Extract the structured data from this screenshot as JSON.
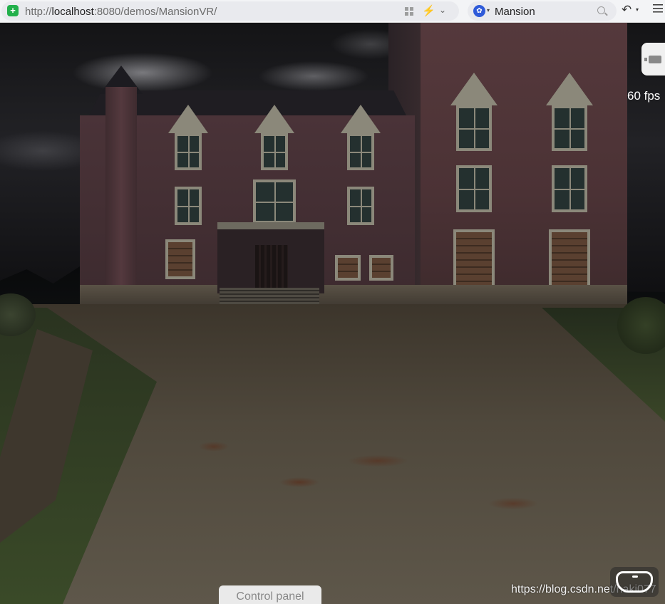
{
  "browser": {
    "url_prefix": "http://",
    "url_host": "localhost",
    "url_rest": ":8080/demos/MansionVR/",
    "search_text": "Mansion"
  },
  "scene": {
    "fps_label": "60 fps",
    "control_panel_label": "Control panel"
  },
  "watermark": "https://blog.csdn.net/naki077",
  "icons": {
    "shield": "shield-icon",
    "qr": "qr-code-icon",
    "bolt": "lightning-icon",
    "search_engine": "baidu-paw-icon",
    "search": "search-icon",
    "undo": "undo-icon",
    "menu": "menu-icon",
    "vr_camera": "camera-icon",
    "vr_headset": "vr-headset-icon"
  },
  "colors": {
    "shield": "#22b04b",
    "bolt": "#18b24a",
    "search_engine": "#2f5bd9"
  }
}
